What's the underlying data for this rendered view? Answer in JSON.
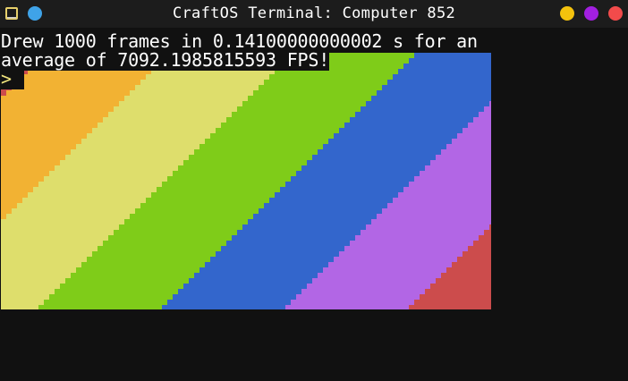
{
  "window": {
    "title": "CraftOS Terminal: Computer 852",
    "left_button_color": "#3fa3e8",
    "right_buttons": [
      {
        "name": "minimize",
        "color": "#f4c20d"
      },
      {
        "name": "maximize",
        "color": "#a21fe0"
      },
      {
        "name": "close",
        "color": "#f24b4b"
      }
    ]
  },
  "terminal": {
    "lines": [
      "Drew 1000 frames in 0.14100000000002 s for an",
      "average of 7092.1985815593 FPS!"
    ],
    "prompt": ">"
  },
  "rainbow": {
    "colors": [
      "#cc4c4c",
      "#f2b233",
      "#dede6c",
      "#7fcc19",
      "#3366cc",
      "#b266e5",
      "#cc4c4c"
    ]
  }
}
